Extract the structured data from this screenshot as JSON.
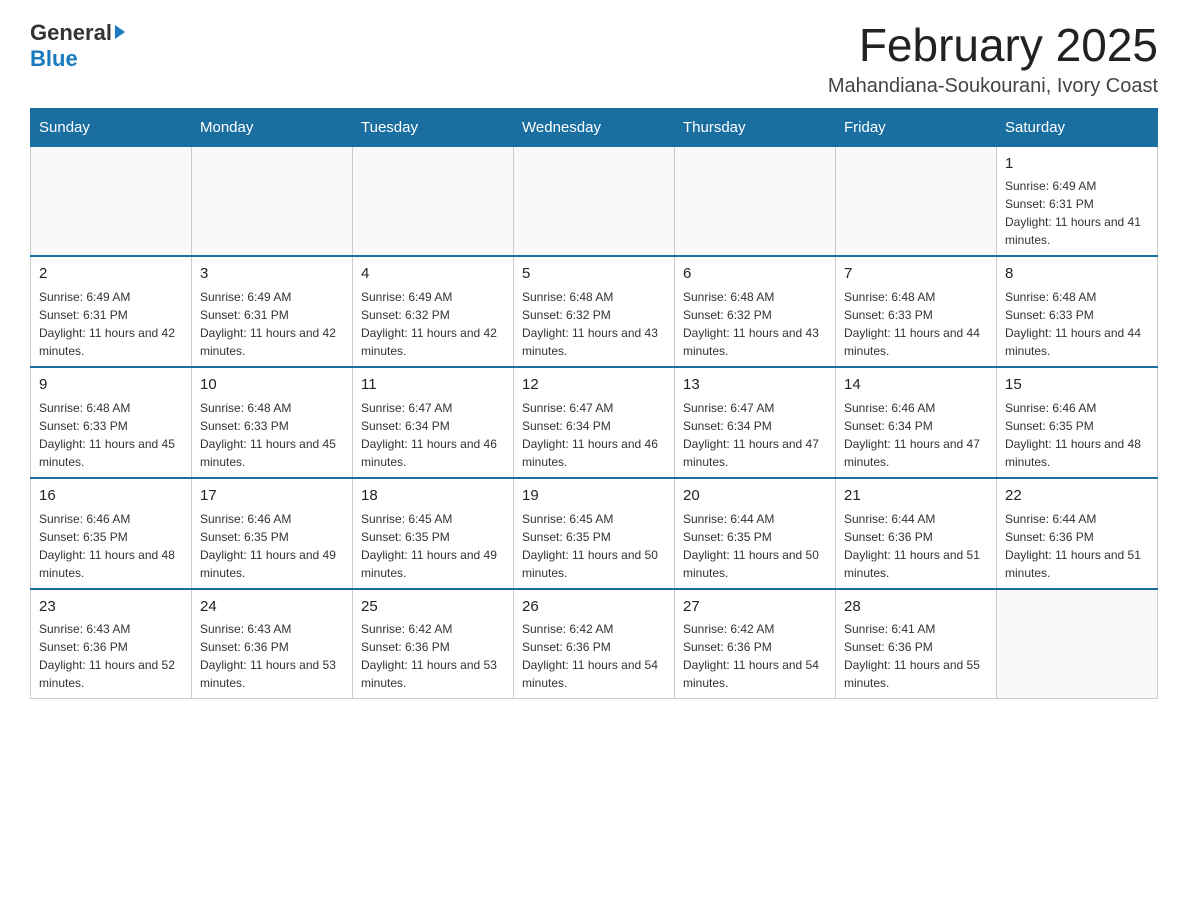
{
  "logo": {
    "general": "General",
    "blue": "Blue"
  },
  "title": "February 2025",
  "subtitle": "Mahandiana-Soukourani, Ivory Coast",
  "days_of_week": [
    "Sunday",
    "Monday",
    "Tuesday",
    "Wednesday",
    "Thursday",
    "Friday",
    "Saturday"
  ],
  "weeks": [
    [
      {
        "day": "",
        "info": ""
      },
      {
        "day": "",
        "info": ""
      },
      {
        "day": "",
        "info": ""
      },
      {
        "day": "",
        "info": ""
      },
      {
        "day": "",
        "info": ""
      },
      {
        "day": "",
        "info": ""
      },
      {
        "day": "1",
        "info": "Sunrise: 6:49 AM\nSunset: 6:31 PM\nDaylight: 11 hours and 41 minutes."
      }
    ],
    [
      {
        "day": "2",
        "info": "Sunrise: 6:49 AM\nSunset: 6:31 PM\nDaylight: 11 hours and 42 minutes."
      },
      {
        "day": "3",
        "info": "Sunrise: 6:49 AM\nSunset: 6:31 PM\nDaylight: 11 hours and 42 minutes."
      },
      {
        "day": "4",
        "info": "Sunrise: 6:49 AM\nSunset: 6:32 PM\nDaylight: 11 hours and 42 minutes."
      },
      {
        "day": "5",
        "info": "Sunrise: 6:48 AM\nSunset: 6:32 PM\nDaylight: 11 hours and 43 minutes."
      },
      {
        "day": "6",
        "info": "Sunrise: 6:48 AM\nSunset: 6:32 PM\nDaylight: 11 hours and 43 minutes."
      },
      {
        "day": "7",
        "info": "Sunrise: 6:48 AM\nSunset: 6:33 PM\nDaylight: 11 hours and 44 minutes."
      },
      {
        "day": "8",
        "info": "Sunrise: 6:48 AM\nSunset: 6:33 PM\nDaylight: 11 hours and 44 minutes."
      }
    ],
    [
      {
        "day": "9",
        "info": "Sunrise: 6:48 AM\nSunset: 6:33 PM\nDaylight: 11 hours and 45 minutes."
      },
      {
        "day": "10",
        "info": "Sunrise: 6:48 AM\nSunset: 6:33 PM\nDaylight: 11 hours and 45 minutes."
      },
      {
        "day": "11",
        "info": "Sunrise: 6:47 AM\nSunset: 6:34 PM\nDaylight: 11 hours and 46 minutes."
      },
      {
        "day": "12",
        "info": "Sunrise: 6:47 AM\nSunset: 6:34 PM\nDaylight: 11 hours and 46 minutes."
      },
      {
        "day": "13",
        "info": "Sunrise: 6:47 AM\nSunset: 6:34 PM\nDaylight: 11 hours and 47 minutes."
      },
      {
        "day": "14",
        "info": "Sunrise: 6:46 AM\nSunset: 6:34 PM\nDaylight: 11 hours and 47 minutes."
      },
      {
        "day": "15",
        "info": "Sunrise: 6:46 AM\nSunset: 6:35 PM\nDaylight: 11 hours and 48 minutes."
      }
    ],
    [
      {
        "day": "16",
        "info": "Sunrise: 6:46 AM\nSunset: 6:35 PM\nDaylight: 11 hours and 48 minutes."
      },
      {
        "day": "17",
        "info": "Sunrise: 6:46 AM\nSunset: 6:35 PM\nDaylight: 11 hours and 49 minutes."
      },
      {
        "day": "18",
        "info": "Sunrise: 6:45 AM\nSunset: 6:35 PM\nDaylight: 11 hours and 49 minutes."
      },
      {
        "day": "19",
        "info": "Sunrise: 6:45 AM\nSunset: 6:35 PM\nDaylight: 11 hours and 50 minutes."
      },
      {
        "day": "20",
        "info": "Sunrise: 6:44 AM\nSunset: 6:35 PM\nDaylight: 11 hours and 50 minutes."
      },
      {
        "day": "21",
        "info": "Sunrise: 6:44 AM\nSunset: 6:36 PM\nDaylight: 11 hours and 51 minutes."
      },
      {
        "day": "22",
        "info": "Sunrise: 6:44 AM\nSunset: 6:36 PM\nDaylight: 11 hours and 51 minutes."
      }
    ],
    [
      {
        "day": "23",
        "info": "Sunrise: 6:43 AM\nSunset: 6:36 PM\nDaylight: 11 hours and 52 minutes."
      },
      {
        "day": "24",
        "info": "Sunrise: 6:43 AM\nSunset: 6:36 PM\nDaylight: 11 hours and 53 minutes."
      },
      {
        "day": "25",
        "info": "Sunrise: 6:42 AM\nSunset: 6:36 PM\nDaylight: 11 hours and 53 minutes."
      },
      {
        "day": "26",
        "info": "Sunrise: 6:42 AM\nSunset: 6:36 PM\nDaylight: 11 hours and 54 minutes."
      },
      {
        "day": "27",
        "info": "Sunrise: 6:42 AM\nSunset: 6:36 PM\nDaylight: 11 hours and 54 minutes."
      },
      {
        "day": "28",
        "info": "Sunrise: 6:41 AM\nSunset: 6:36 PM\nDaylight: 11 hours and 55 minutes."
      },
      {
        "day": "",
        "info": ""
      }
    ]
  ]
}
